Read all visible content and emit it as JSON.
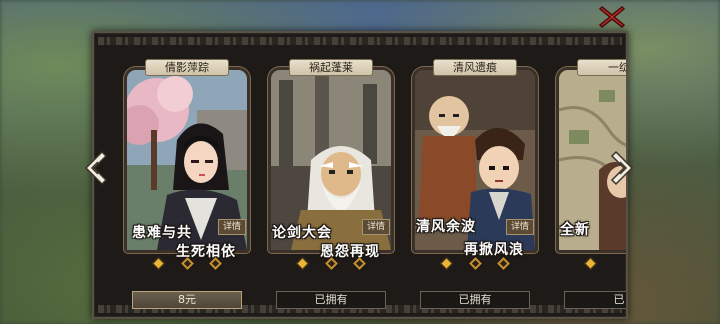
{
  "panel": {
    "close_icon": "close-x-icon",
    "nav_left_icon": "chevron-left-icon",
    "nav_right_icon": "chevron-right-icon"
  },
  "cards": [
    {
      "title": "倩影萍踪",
      "slogan_line1": "患难与共",
      "slogan_line2": "生死相依",
      "detail_label": "详情",
      "status": "8元",
      "status_type": "price",
      "diamonds": [
        "filled",
        "hollow",
        "hollow"
      ]
    },
    {
      "title": "祸起蓬莱",
      "slogan_line1": "论剑大会",
      "slogan_line2": "恩怨再现",
      "detail_label": "详情",
      "status": "已拥有",
      "status_type": "owned",
      "diamonds": [
        "filled",
        "hollow",
        "hollow"
      ]
    },
    {
      "title": "清风遗痕",
      "slogan_line1": "清风余波",
      "slogan_line2": "再掀风浪",
      "detail_label": "详情",
      "status": "已拥有",
      "status_type": "owned",
      "diamonds": [
        "filled",
        "hollow",
        "hollow"
      ]
    },
    {
      "title": "一绽",
      "slogan_line1": "全新",
      "slogan_line2": "",
      "detail_label": "",
      "status": "已",
      "status_type": "owned",
      "diamonds": [
        "filled"
      ]
    }
  ],
  "colors": {
    "frame_dark": "#1d1a17",
    "gold": "#e7b53a",
    "close_red": "#c8302a"
  }
}
